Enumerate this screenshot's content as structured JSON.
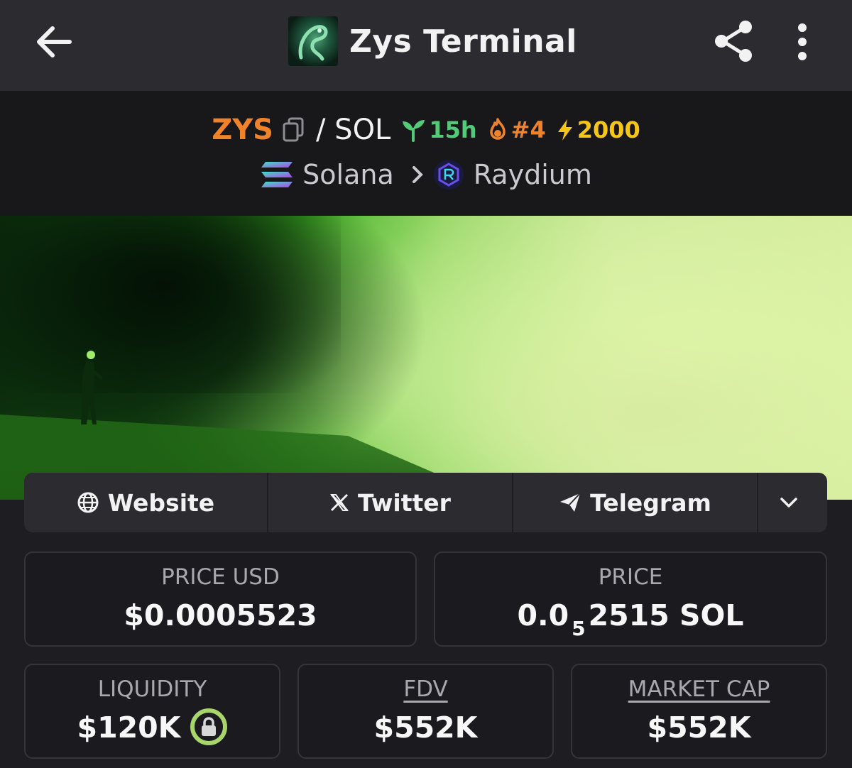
{
  "appbar": {
    "title": "Zys Terminal",
    "back_icon": "arrow-left-icon",
    "share_icon": "share-icon",
    "more_icon": "more-vertical-icon"
  },
  "pair": {
    "base_symbol": "ZYS",
    "separator_quote": "/ SOL",
    "age": "15h",
    "rank": "#4",
    "boost": "2000",
    "chain": "Solana",
    "dex": "Raydium"
  },
  "links": {
    "website": "Website",
    "twitter": "Twitter",
    "telegram": "Telegram"
  },
  "stats": {
    "price_usd_label": "PRICE USD",
    "price_usd_value": "$0.0005523",
    "price_label": "PRICE",
    "price_prefix": "0.0",
    "price_subscript": "5",
    "price_suffix": "2515 SOL",
    "liquidity_label": "LIQUIDITY",
    "liquidity_value": "$120K",
    "fdv_label": "FDV",
    "fdv_value": "$552K",
    "mcap_label": "MARKET CAP",
    "mcap_value": "$552K"
  },
  "colors": {
    "base_symbol": "#f0832a",
    "age_badge": "#55c97a",
    "rank_badge": "#f0832a",
    "boost_badge": "#f5c518",
    "lock_ring": "#a9d66a"
  }
}
